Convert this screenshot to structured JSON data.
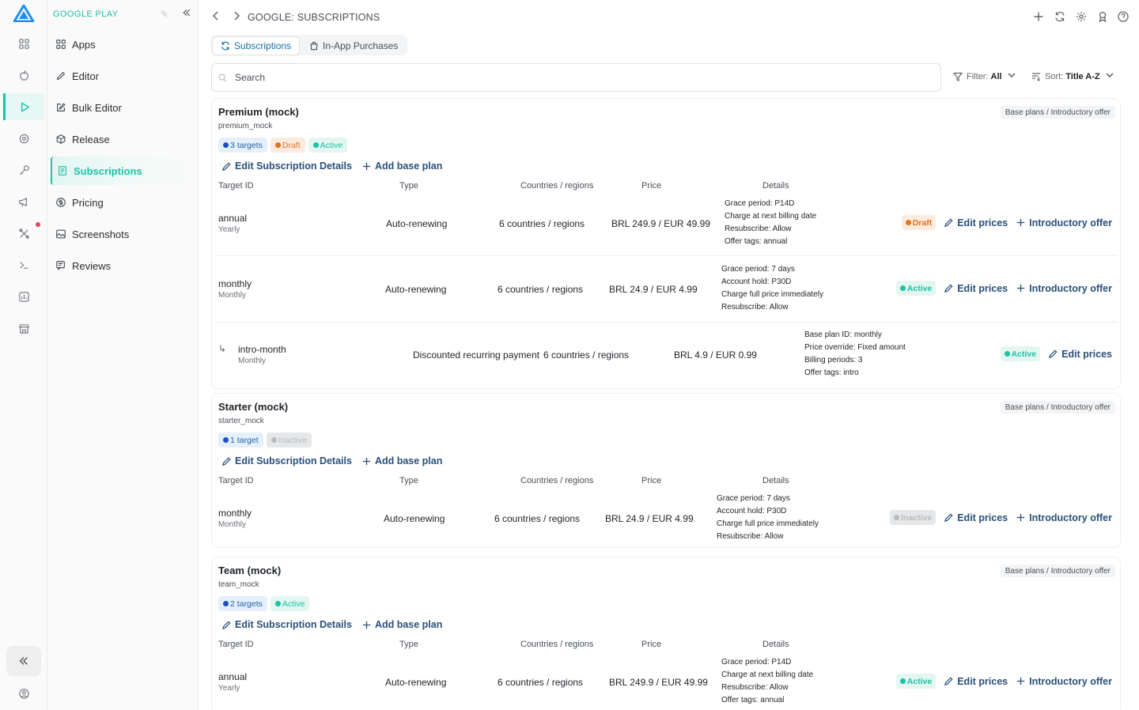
{
  "app": {
    "section_title": "GOOGLE PLAY"
  },
  "rail": {
    "icons": [
      "apps-icon",
      "apple-icon",
      "play-icon",
      "settings-icon",
      "key-icon",
      "megaphone-icon",
      "tools-icon",
      "terminal-icon",
      "chart-icon",
      "store-icon"
    ],
    "active": "play-icon",
    "accent": "#1cc2a8",
    "notification_color": "#e5484d"
  },
  "sidebar": {
    "items": [
      {
        "label": "Apps",
        "icon": "grid-icon"
      },
      {
        "label": "Editor",
        "icon": "pencil-icon"
      },
      {
        "label": "Bulk Editor",
        "icon": "edit-box-icon"
      },
      {
        "label": "Release",
        "icon": "box-icon"
      },
      {
        "label": "Subscriptions",
        "icon": "receipt-icon"
      },
      {
        "label": "Pricing",
        "icon": "dollar-icon"
      },
      {
        "label": "Screenshots",
        "icon": "image-icon"
      },
      {
        "label": "Reviews",
        "icon": "reviews-icon"
      }
    ],
    "active": "Subscriptions"
  },
  "header": {
    "breadcrumb": "GOOGLE: SUBSCRIPTIONS"
  },
  "tabs": [
    {
      "label": "Subscriptions",
      "active": true
    },
    {
      "label": "In-App Purchases",
      "active": false
    }
  ],
  "search": {
    "placeholder": "Search",
    "value": ""
  },
  "filter": {
    "label": "Filter:",
    "value": "All"
  },
  "sort": {
    "label": "Sort:",
    "value": "Title A-Z"
  },
  "actions": {
    "edit_details": "Edit Subscription Details",
    "add_base_plan": "Add base plan",
    "edit_prices": "Edit prices",
    "intro_offer": "Introductory offer",
    "tag_right": "Base plans / Introductory offer"
  },
  "columns": {
    "target": "Target ID",
    "type": "Type",
    "countries": "Countries / regions",
    "price": "Price",
    "details": "Details"
  },
  "cards": [
    {
      "title": "Premium (mock)",
      "id": "premium_mock",
      "targets": "3 targets",
      "badges": [
        "Draft",
        "Active"
      ],
      "rows": [
        {
          "name": "annual",
          "period": "Yearly",
          "type": "Auto-renewing",
          "countries": "6 countries / regions",
          "price": "BRL 249.9 / EUR 49.99",
          "details": [
            "Grace period: P14D",
            "Charge at next billing date",
            "Resubscribe: Allow",
            "Offer tags: annual"
          ],
          "status": "Draft"
        },
        {
          "name": "monthly",
          "period": "Monthly",
          "type": "Auto-renewing",
          "countries": "6 countries / regions",
          "price": "BRL 24.9 / EUR 4.99",
          "details": [
            "Grace period: 7 days",
            "Account hold: P30D",
            "Charge full price immediately",
            "Resubscribe: Allow"
          ],
          "status": "Active"
        },
        {
          "name": "intro-month",
          "period": "Monthly",
          "type": "Discounted recurring payment",
          "countries": "6 countries / regions",
          "price": "BRL 4.9 / EUR 0.99",
          "details": [
            "Base plan ID: monthly",
            "Price override: Fixed amount",
            "Billing periods: 3",
            "Offer tags: intro"
          ],
          "status": "Active"
        }
      ]
    },
    {
      "title": "Starter (mock)",
      "id": "starter_mock",
      "targets": "1 target",
      "badges": [
        "Inactive"
      ],
      "rows": [
        {
          "name": "monthly",
          "period": "Monthly",
          "type": "Auto-renewing",
          "countries": "6 countries / regions",
          "price": "BRL 24.9 / EUR 4.99",
          "details": [
            "Grace period: 7 days",
            "Account hold: P30D",
            "Charge full price immediately",
            "Resubscribe: Allow"
          ],
          "status": "Inactive"
        }
      ]
    },
    {
      "title": "Team (mock)",
      "id": "team_mock",
      "targets": "2 targets",
      "badges": [
        "Active"
      ],
      "rows": [
        {
          "name": "annual",
          "period": "Yearly",
          "type": "Auto-renewing",
          "countries": "6 countries / regions",
          "price": "BRL 249.9 / EUR 49.99",
          "details": [
            "Grace period: P14D",
            "Charge at next billing date",
            "Resubscribe: Allow",
            "Offer tags: annual"
          ],
          "status": "Active"
        }
      ]
    }
  ]
}
